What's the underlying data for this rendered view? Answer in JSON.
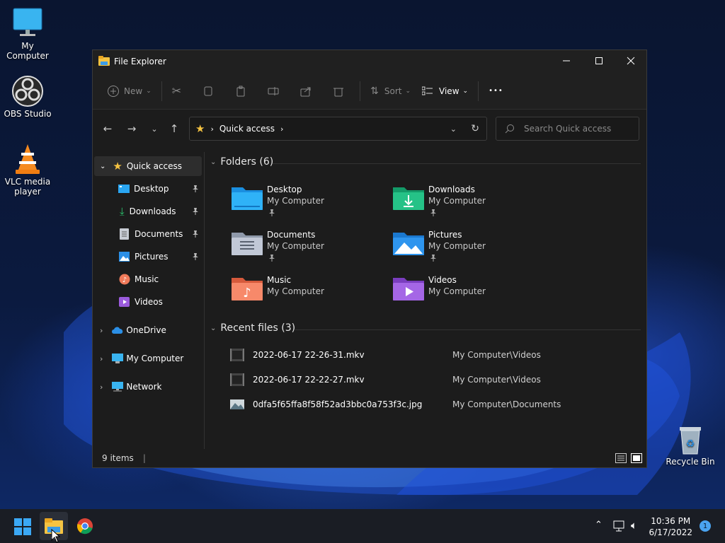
{
  "desktop": {
    "icons": [
      {
        "label": "My Computer",
        "icon": "monitor-icon"
      },
      {
        "label": "OBS Studio",
        "icon": "obs-icon"
      },
      {
        "label": "VLC media\nplayer",
        "icon": "vlc-cone-icon"
      },
      {
        "label": "Recycle Bin",
        "icon": "recycle-bin-icon"
      }
    ]
  },
  "window": {
    "title": "File Explorer",
    "toolbar": {
      "new": "New",
      "sort": "Sort",
      "view": "View",
      "more": "•••"
    },
    "address": {
      "path": "Quick access"
    },
    "search": {
      "placeholder": "Search Quick access"
    },
    "sidebar": {
      "quick_access": "Quick access",
      "pinned": [
        "Desktop",
        "Downloads",
        "Documents",
        "Pictures"
      ],
      "unpinned": [
        "Music",
        "Videos"
      ],
      "onedrive": "OneDrive",
      "my_computer": "My Computer",
      "network": "Network"
    },
    "folders": {
      "header": "Folders (6)",
      "items": [
        {
          "name": "Desktop",
          "location": "My Computer",
          "pinned": true,
          "color": "#1ea0ff"
        },
        {
          "name": "Downloads",
          "location": "My Computer",
          "pinned": true,
          "color": "#1fb37a"
        },
        {
          "name": "Documents",
          "location": "My Computer",
          "pinned": true,
          "color": "#aab4c8"
        },
        {
          "name": "Pictures",
          "location": "My Computer",
          "pinned": true,
          "color": "#2a8fe8"
        },
        {
          "name": "Music",
          "location": "My Computer",
          "pinned": false,
          "color": "#f07a5a"
        },
        {
          "name": "Videos",
          "location": "My Computer",
          "pinned": false,
          "color": "#9b5bdc"
        }
      ]
    },
    "recent": {
      "header": "Recent files (3)",
      "items": [
        {
          "name": "2022-06-17 22-26-31.mkv",
          "location": "My Computer\\Videos"
        },
        {
          "name": "2022-06-17 22-22-27.mkv",
          "location": "My Computer\\Videos"
        },
        {
          "name": "0dfa5f65ffa8f58f52ad3bbc0a753f3c.jpg",
          "location": "My Computer\\Documents"
        }
      ]
    },
    "status": {
      "items": "9 items",
      "cursor": "|"
    }
  },
  "taskbar": {
    "time": "10:36 PM",
    "date": "6/17/2022",
    "notification_count": "1"
  }
}
